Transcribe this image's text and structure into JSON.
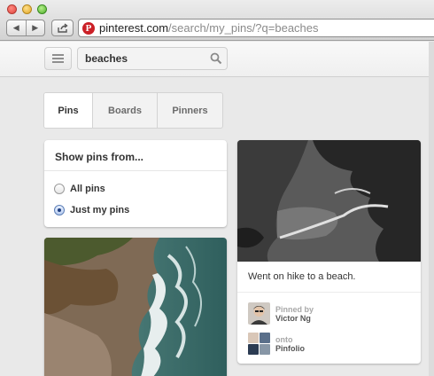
{
  "browser": {
    "url_domain": "pinterest.com",
    "url_path": "/search/my_pins/?q=beaches",
    "logo_letter": "P",
    "back_glyph": "◀",
    "forward_glyph": "▶"
  },
  "header": {
    "search_value": "beaches"
  },
  "tabs": [
    {
      "label": "Pins",
      "active": true
    },
    {
      "label": "Boards",
      "active": false
    },
    {
      "label": "Pinners",
      "active": false
    }
  ],
  "filter": {
    "title": "Show pins from...",
    "options": [
      {
        "label": "All pins",
        "selected": false
      },
      {
        "label": "Just my pins",
        "selected": true
      }
    ]
  },
  "pin": {
    "caption": "Went on hike to a beach.",
    "pinned_by_label": "Pinned by",
    "pinner_name": "Victor Ng",
    "onto_label": "onto",
    "board_name": "Pinfolio"
  },
  "colors": {
    "pinterest_red": "#cb2027",
    "accent_radio": "#1f3f80"
  }
}
